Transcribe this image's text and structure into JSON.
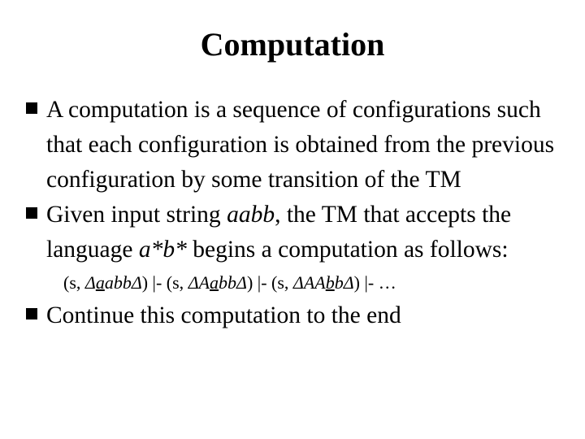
{
  "slide": {
    "title": "Computation",
    "bullets": [
      {
        "marker": "square-bullet",
        "text": "A computation is a sequence of configurations such that each configuration is obtained from the previous configuration by some transition of the TM"
      },
      {
        "marker": "square-bullet",
        "text_before_italic1": "Given input string ",
        "italic1": "aabb",
        "text_between": ", the TM that accepts the language ",
        "italic2": "a*b*",
        "text_after": " begins a computation as follows:"
      },
      {
        "marker": "square-bullet",
        "text": "Continue this computation to the end"
      }
    ],
    "configuration_line": {
      "full_text": "(s, ΔaabbΔ) |- (s, ΔAabbΔ) |- (s, ΔAAbbΔ) |- …",
      "segments": [
        {
          "text": "(s, ",
          "style": "roman"
        },
        {
          "text": "Δ",
          "style": "italic"
        },
        {
          "text": "a",
          "style": "italic-underline"
        },
        {
          "text": "abb",
          "style": "italic"
        },
        {
          "text": "Δ",
          "style": "italic"
        },
        {
          "text": ") |- (s, ",
          "style": "roman"
        },
        {
          "text": "ΔA",
          "style": "italic"
        },
        {
          "text": "a",
          "style": "italic-underline"
        },
        {
          "text": "bb",
          "style": "italic"
        },
        {
          "text": "Δ",
          "style": "italic"
        },
        {
          "text": ") |- (s, ",
          "style": "roman"
        },
        {
          "text": "ΔAA",
          "style": "italic"
        },
        {
          "text": "b",
          "style": "italic-underline"
        },
        {
          "text": "b",
          "style": "italic"
        },
        {
          "text": "Δ",
          "style": "italic"
        },
        {
          "text": ") |- …",
          "style": "roman"
        }
      ],
      "parts": {
        "open1": "(s, ",
        "delta1": "Δ",
        "underlined1": "a",
        "rest1": "abb",
        "delta1_end": "Δ",
        "sep1": ") |- (s, ",
        "delta2": "ΔA",
        "underlined2": "a",
        "rest2": "bb",
        "delta2_end": "Δ",
        "sep2": ") |- (s, ",
        "delta3": "ΔAA",
        "underlined3": "b",
        "rest3": "b",
        "delta3_end": "Δ",
        "tail": ") |- …"
      }
    }
  },
  "colors": {
    "background": "#ffffff",
    "text": "#000000",
    "bullet": "#000000"
  }
}
